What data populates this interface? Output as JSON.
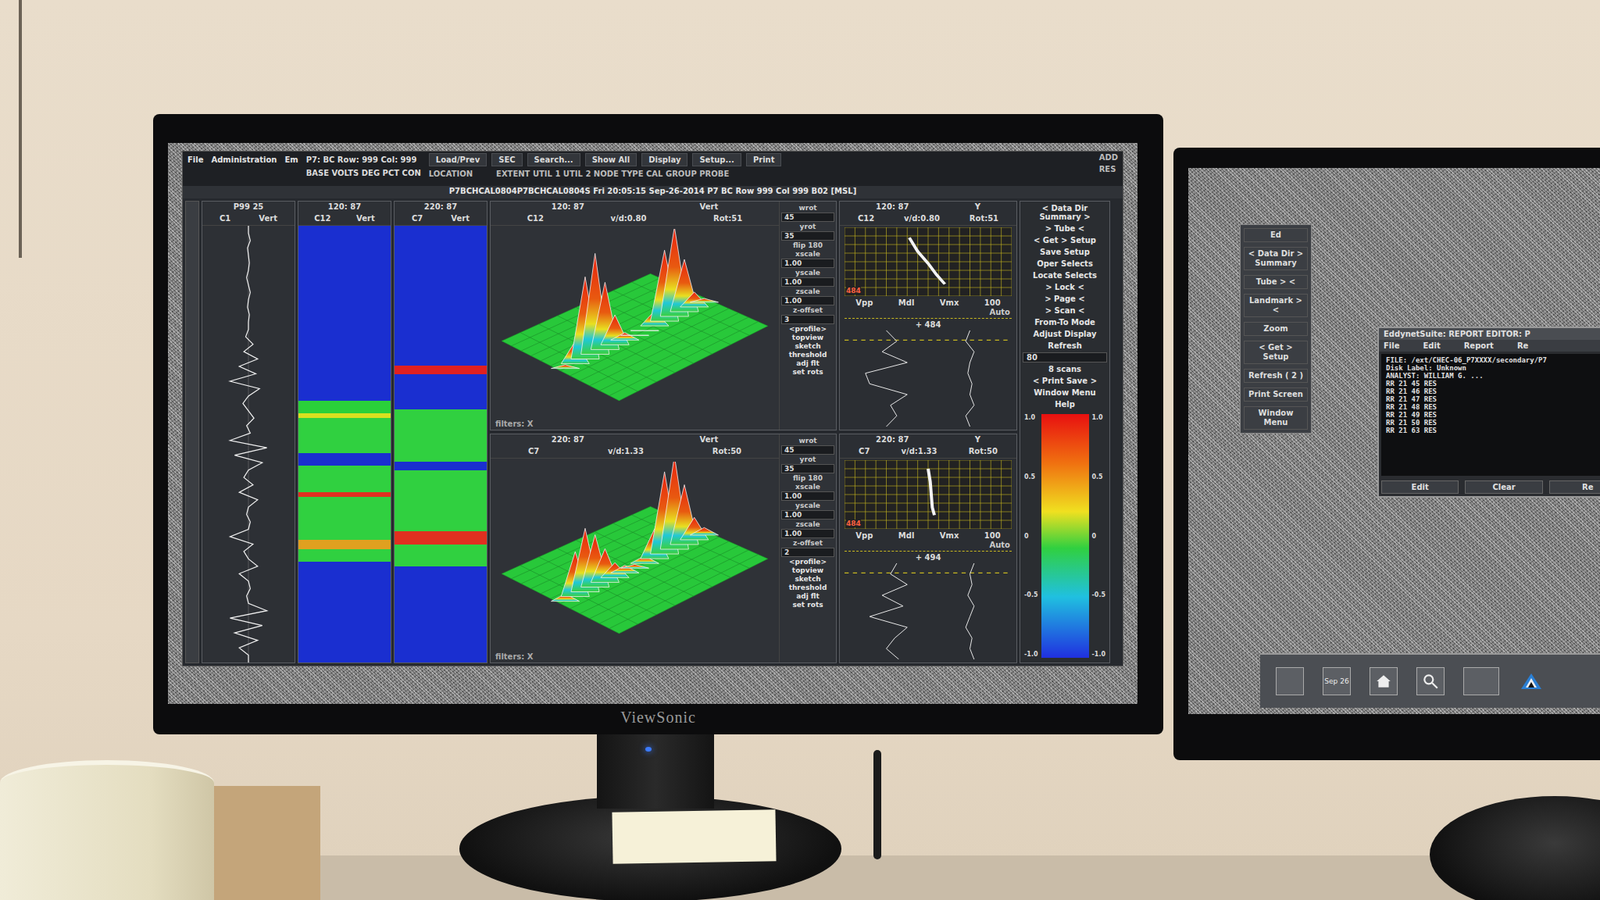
{
  "scene": {
    "brand": "ViewSonic"
  },
  "left_screen": {
    "menubar": [
      "File",
      "Administration",
      "Em"
    ],
    "status": [
      "P7: BC  Row: 999  Col: 999",
      "BASE  VOLTS DEG PCT CON"
    ],
    "toolbar": [
      "Load/Prev",
      "SEC",
      "Search...",
      "Show All",
      "Display",
      "Setup...",
      "Print"
    ],
    "toolbar_sub": [
      "LOCATION",
      "EXTENT  UTIL 1  UTIL 2  NODE  TYPE  CAL GROUP  PROBE"
    ],
    "corner": [
      "ADD",
      "RES"
    ],
    "title": "P7BCHCAL0804P7BCHCAL0804S  Fri 20:05:15 Sep-26-2014  P7 BC  Row 999 Col 999  B02 [MSL]",
    "strips": [
      {
        "header": "P99  25",
        "channel": "C1",
        "mode": "Vert",
        "kind": "trace",
        "trace": [
          50,
          50,
          52,
          49,
          50,
          51,
          50,
          48,
          50,
          52,
          50,
          49,
          51,
          50,
          50,
          47,
          55,
          45,
          60,
          40,
          58,
          30,
          62,
          50,
          44,
          50,
          56,
          48,
          52,
          30,
          70,
          35,
          65,
          50,
          45,
          55,
          40,
          60,
          50,
          48,
          52,
          50,
          30,
          55,
          45,
          50,
          60,
          40,
          50,
          52,
          48,
          50,
          70,
          30,
          65,
          35,
          60,
          40,
          50,
          50
        ]
      },
      {
        "header": "120: 87",
        "channel": "C12",
        "mode": "Vert",
        "kind": "bands",
        "bands": [
          {
            "color": "#1a2fd0",
            "share": 0.4
          },
          {
            "color": "#2ad03a",
            "share": 0.03
          },
          {
            "color": "#d8e020",
            "share": 0.01
          },
          {
            "color": "#30d040",
            "share": 0.08
          },
          {
            "color": "#1a2fd0",
            "share": 0.03
          },
          {
            "color": "#30d040",
            "share": 0.06
          },
          {
            "color": "#e03020",
            "share": 0.01
          },
          {
            "color": "#30d040",
            "share": 0.1
          },
          {
            "color": "#e0a020",
            "share": 0.02
          },
          {
            "color": "#30d040",
            "share": 0.03
          },
          {
            "color": "#1a2fd0",
            "share": 0.23
          }
        ]
      },
      {
        "header": "220: 87",
        "channel": "C7",
        "mode": "Vert",
        "kind": "bands",
        "bands": [
          {
            "color": "#1a2fd0",
            "share": 0.32
          },
          {
            "color": "#e02020",
            "share": 0.02
          },
          {
            "color": "#1a2fd0",
            "share": 0.08
          },
          {
            "color": "#30d040",
            "share": 0.12
          },
          {
            "color": "#1a2fd0",
            "share": 0.02
          },
          {
            "color": "#30d040",
            "share": 0.14
          },
          {
            "color": "#e03020",
            "share": 0.03
          },
          {
            "color": "#30d040",
            "share": 0.05
          },
          {
            "color": "#1a2fd0",
            "share": 0.22
          }
        ]
      }
    ],
    "plots3d": [
      {
        "header": "120: 87",
        "channel": "C12",
        "vd": "v/d:0.80",
        "rot": "Rot:51",
        "mode": "Vert",
        "footer": "filters: X",
        "peaks": [
          5,
          30,
          110,
          135,
          90,
          40,
          10,
          0,
          0,
          20,
          95,
          120,
          70,
          20,
          5
        ],
        "controls": [
          {
            "text": "wrot",
            "kind": "label"
          },
          {
            "text": "45",
            "kind": "field"
          },
          {
            "text": "yrot",
            "kind": "label"
          },
          {
            "text": "35",
            "kind": "field"
          },
          {
            "text": "flip 180",
            "kind": "label"
          },
          {
            "text": "xscale",
            "kind": "label"
          },
          {
            "text": "1.00",
            "kind": "field"
          },
          {
            "text": "yscale",
            "kind": "label"
          },
          {
            "text": "1.00",
            "kind": "field"
          },
          {
            "text": "zscale",
            "kind": "label"
          },
          {
            "text": "1.00",
            "kind": "field"
          },
          {
            "text": "z-offset",
            "kind": "label"
          },
          {
            "text": "3",
            "kind": "field"
          },
          {
            "text": "<profile>",
            "kind": "button"
          },
          {
            "text": "topview",
            "kind": "button"
          },
          {
            "text": "sketch",
            "kind": "button"
          },
          {
            "text": "threshold",
            "kind": "button"
          },
          {
            "text": "adj flt",
            "kind": "button"
          },
          {
            "text": "set rots",
            "kind": "button"
          }
        ]
      },
      {
        "header": "220: 87",
        "channel": "C7",
        "vd": "v/d:1.33",
        "rot": "Rot:50",
        "mode": "Vert",
        "footer": "filters: X",
        "peaks": [
          10,
          60,
          85,
          70,
          45,
          20,
          10,
          5,
          10,
          40,
          110,
          125,
          80,
          30,
          10
        ],
        "controls": [
          {
            "text": "wrot",
            "kind": "label"
          },
          {
            "text": "45",
            "kind": "field"
          },
          {
            "text": "yrot",
            "kind": "label"
          },
          {
            "text": "35",
            "kind": "field"
          },
          {
            "text": "flip 180",
            "kind": "label"
          },
          {
            "text": "xscale",
            "kind": "label"
          },
          {
            "text": "1.00",
            "kind": "field"
          },
          {
            "text": "yscale",
            "kind": "label"
          },
          {
            "text": "1.00",
            "kind": "field"
          },
          {
            "text": "zscale",
            "kind": "label"
          },
          {
            "text": "1.00",
            "kind": "field"
          },
          {
            "text": "z-offset",
            "kind": "label"
          },
          {
            "text": "2",
            "kind": "field"
          },
          {
            "text": "<profile>",
            "kind": "button"
          },
          {
            "text": "topview",
            "kind": "button"
          },
          {
            "text": "sketch",
            "kind": "button"
          },
          {
            "text": "threshold",
            "kind": "button"
          },
          {
            "text": "adj flt",
            "kind": "button"
          },
          {
            "text": "set rots",
            "kind": "button"
          }
        ]
      }
    ],
    "lissajous": [
      {
        "header": "120: 87",
        "axis": "Y",
        "channel": "C12",
        "vd": "v/d:0.80",
        "rot": "Rot:51",
        "marker": "484",
        "labels": [
          "Vpp",
          "Mdl",
          "Vmx",
          "100"
        ],
        "auto": "Auto",
        "scale": "+ 484",
        "trace": [
          [
            62,
            12
          ],
          [
            70,
            28
          ],
          [
            80,
            42
          ],
          [
            88,
            55
          ],
          [
            96,
            66
          ]
        ],
        "traces": [
          [
            20,
            25,
            18,
            30,
            10,
            12,
            30,
            22,
            25,
            20
          ],
          [
            60,
            58,
            62,
            60,
            59,
            61,
            60,
            62,
            58,
            60
          ]
        ]
      },
      {
        "header": "220: 87",
        "axis": "Y",
        "channel": "C7",
        "vd": "v/d:1.33",
        "rot": "Rot:50",
        "marker": "484",
        "labels": [
          "Vpp",
          "Mdl",
          "Vmx",
          "100"
        ],
        "auto": "Auto",
        "scale": "+ 494",
        "trace": [
          [
            80,
            10
          ],
          [
            82,
            25
          ],
          [
            83,
            40
          ],
          [
            84,
            55
          ],
          [
            86,
            64
          ]
        ],
        "traces": [
          [
            25,
            22,
            30,
            18,
            28,
            12,
            30,
            24,
            20,
            26
          ],
          [
            62,
            60,
            61,
            59,
            62,
            60,
            58,
            61,
            60,
            62
          ]
        ]
      }
    ],
    "buttons": [
      "< Data Dir Summary >",
      "> Tube <",
      "< Get > Setup",
      "Save Setup",
      "Oper Selects",
      "Locate Selects",
      "> Lock <",
      "> Page <",
      "> Scan <",
      "From-To Mode",
      "Adjust Display",
      "Refresh"
    ],
    "scan_field": "80",
    "buttons_after": [
      "8 scans",
      "< Print Save >",
      "Window Menu",
      "Help"
    ],
    "colorbar": [
      "1.0",
      "0.5",
      "0",
      "-0.5",
      "-1.0"
    ]
  },
  "right_screen": {
    "sidebar": [
      "Ed",
      "< Data Dir > Summary",
      "Tube > <",
      "Landmark > <",
      "Zoom",
      "< Get > Setup",
      "Refresh ( 2 )",
      "Print Screen",
      "Window Menu"
    ],
    "report": {
      "title": "EddynetSuite: REPORT EDITOR: P",
      "menu": [
        "File",
        "Edit",
        "Report",
        "Re"
      ],
      "header": [
        "FILE: /ext/CHEC-06_P7XXXX/secondary/P7",
        "Disk Label: Unknown",
        "ANALYST: WILLIAM G. ..."
      ],
      "rows": [
        "RR  21  45    RES",
        "RR  21  46    RES",
        "RR  21  47    RES",
        "RR  21  48    RES",
        "RR  21  49    RES",
        "RR  21  50    RES",
        "RR  21  63    RES"
      ],
      "buttons": [
        "Edit",
        "Clear",
        "Re"
      ]
    },
    "taskbar": {
      "date": "Sep 26"
    }
  }
}
